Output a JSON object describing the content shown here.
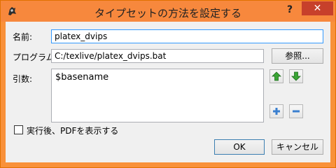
{
  "window": {
    "title": "タイプセットの方法を設定する",
    "help_label": "?",
    "close_label": "✕",
    "app_icon": "texworks-lion-icon"
  },
  "form": {
    "name_label": "名前:",
    "name_value": "platex_dvips",
    "program_label": "プログラム:",
    "program_value": "C:/texlive/platex_dvips.bat",
    "browse_label": "参照...",
    "args_label": "引数:",
    "args_items": [
      "$basename"
    ],
    "move_up_icon": "green-up-arrow-icon",
    "move_down_icon": "green-down-arrow-icon",
    "add_icon": "plus-icon",
    "remove_icon": "minus-icon",
    "show_pdf_label": "実行後、PDFを表示する",
    "show_pdf_checked": false
  },
  "buttons": {
    "ok_label": "OK",
    "cancel_label": "キャンセル"
  },
  "colors": {
    "titlebar": "#f7883d",
    "close_button": "#c7402b",
    "client_bg": "#f0f0f0",
    "focus_border": "#3399ff"
  }
}
